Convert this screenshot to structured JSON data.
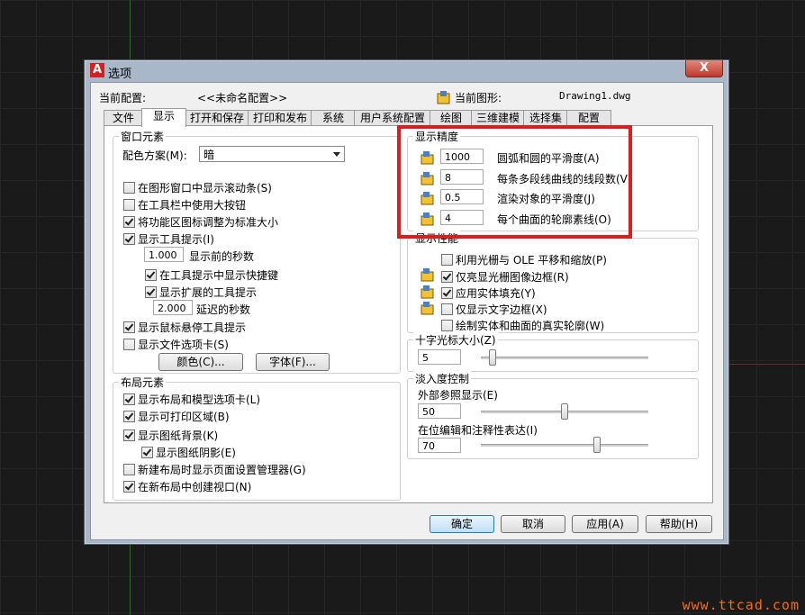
{
  "window": {
    "title": "选项",
    "close": "X"
  },
  "profile": {
    "label": "当前配置:",
    "value": "<<未命名配置>>"
  },
  "drawing": {
    "label": "当前图形:",
    "value": "Drawing1.dwg"
  },
  "tabs": [
    {
      "label": "文件"
    },
    {
      "label": "显示"
    },
    {
      "label": "打开和保存"
    },
    {
      "label": "打印和发布"
    },
    {
      "label": "系统"
    },
    {
      "label": "用户系统配置"
    },
    {
      "label": "绘图"
    },
    {
      "label": "三维建模"
    },
    {
      "label": "选择集"
    },
    {
      "label": "配置"
    }
  ],
  "window_elements": {
    "title": "窗口元素",
    "color_scheme_label": "配色方案(M):",
    "color_scheme_value": "暗",
    "items": [
      {
        "label": "在图形窗口中显示滚动条(S)",
        "checked": false
      },
      {
        "label": "在工具栏中使用大按钮",
        "checked": false
      },
      {
        "label": "将功能区图标调整为标准大小",
        "checked": true
      },
      {
        "label": "显示工具提示(I)",
        "checked": true
      },
      {
        "label": "在工具提示中显示快捷键",
        "checked": true
      },
      {
        "label": "显示扩展的工具提示",
        "checked": true
      },
      {
        "label": "显示鼠标悬停工具提示",
        "checked": true
      },
      {
        "label": "显示文件选项卡(S)",
        "checked": false
      }
    ],
    "delay_value": "1.000",
    "delay_label": "显示前的秒数",
    "ext_delay_value": "2.000",
    "ext_delay_label": "延迟的秒数",
    "colors_button": "颜色(C)...",
    "fonts_button": "字体(F)..."
  },
  "layout_elements": {
    "title": "布局元素",
    "items": [
      {
        "label": "显示布局和模型选项卡(L)",
        "checked": true
      },
      {
        "label": "显示可打印区域(B)",
        "checked": true
      },
      {
        "label": "显示图纸背景(K)",
        "checked": true
      },
      {
        "label": "显示图纸阴影(E)",
        "checked": true
      },
      {
        "label": "新建布局时显示页面设置管理器(G)",
        "checked": false
      },
      {
        "label": "在新布局中创建视口(N)",
        "checked": true
      }
    ]
  },
  "display_resolution": {
    "title": "显示精度",
    "items": [
      {
        "value": "1000",
        "label": "圆弧和圆的平滑度(A)"
      },
      {
        "value": "8",
        "label": "每条多段线曲线的线段数(V)"
      },
      {
        "value": "0.5",
        "label": "渲染对象的平滑度(J)"
      },
      {
        "value": "4",
        "label": "每个曲面的轮廓素线(O)"
      }
    ]
  },
  "display_performance": {
    "title": "显示性能",
    "items": [
      {
        "label": "利用光栅与 OLE 平移和缩放(P)",
        "checked": false
      },
      {
        "label": "仅亮显光栅图像边框(R)",
        "checked": true
      },
      {
        "label": "应用实体填充(Y)",
        "checked": true
      },
      {
        "label": "仅显示文字边框(X)",
        "checked": false
      },
      {
        "label": "绘制实体和曲面的真实轮廓(W)",
        "checked": false
      }
    ]
  },
  "crosshair": {
    "title": "十字光标大小(Z)",
    "value": "5",
    "fraction": 0.05
  },
  "fade": {
    "title": "淡入度控制",
    "xref_label": "外部参照显示(E)",
    "xref_value": "50",
    "xref_fraction": 0.5,
    "inplace_label": "在位编辑和注释性表达(I)",
    "inplace_value": "70",
    "inplace_fraction": 0.7
  },
  "buttons": {
    "ok": "确定",
    "cancel": "取消",
    "apply": "应用(A)",
    "help": "帮助(H)"
  },
  "watermark": "www.ttcad.com",
  "colors": {
    "highlight": "#e01b1b",
    "frame": "#a9b7c9"
  }
}
